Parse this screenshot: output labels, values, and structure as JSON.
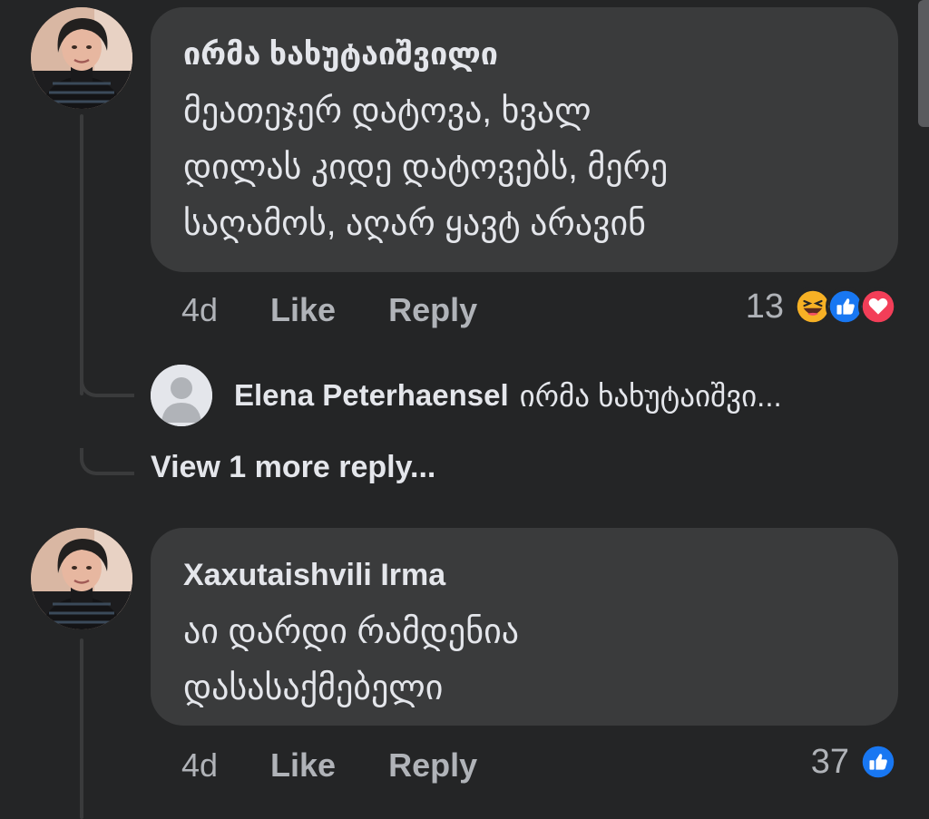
{
  "comments": [
    {
      "author": "ირმა ხახუტაიშვილი",
      "text": "მეათეჯერ დატოვა, ხვალ\nდილას კიდე დატოვებს, მერე\nსაღამოს, აღარ ყავტ არავინ",
      "time": "4d",
      "like_label": "Like",
      "reply_label": "Reply",
      "reaction_count": "13",
      "reactions": [
        "haha-icon",
        "like-icon",
        "love-icon"
      ]
    },
    {
      "author": "Xaxutaishvili Irma",
      "text": "აი დარდი რამდენია\nდასასაქმებელი",
      "time": "4d",
      "like_label": "Like",
      "reply_label": "Reply",
      "reaction_count": "37",
      "reactions": [
        "like-icon"
      ]
    }
  ],
  "reply_preview": {
    "author": "Elena Peterhaensel",
    "text": "ირმა ხახუტაიშვი..."
  },
  "view_more_label": "View 1 more reply...",
  "colors": {
    "background": "#242526",
    "bubble": "#3a3b3c",
    "primary_text": "#e4e6eb",
    "secondary_text": "#b0b3b8",
    "like_blue": "#1877f2",
    "love_red": "#f33e58",
    "haha_yellow": "#f7b125"
  }
}
